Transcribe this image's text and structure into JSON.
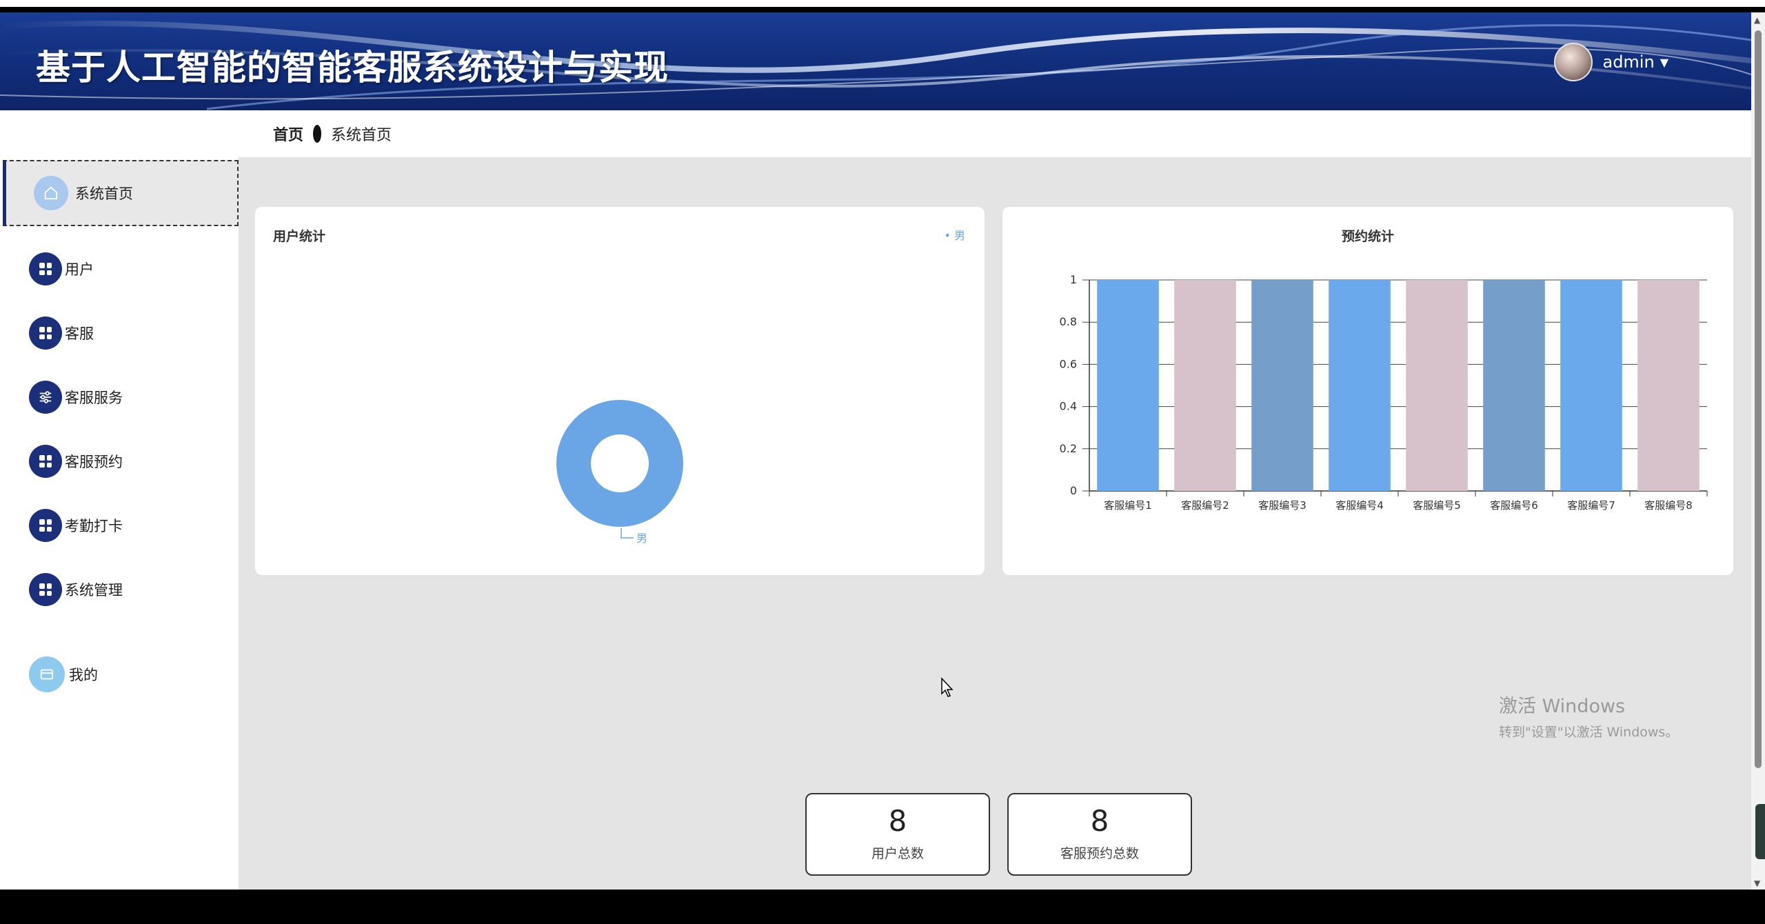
{
  "header": {
    "title": "基于人工智能的智能客服系统设计与实现",
    "username": "admin"
  },
  "breadcrumb": {
    "home": "首页",
    "current": "系统首页"
  },
  "sidebar": {
    "active": {
      "label": "系统首页",
      "icon": "home-icon"
    },
    "items": [
      {
        "label": "用户",
        "icon": "grid-icon"
      },
      {
        "label": "客服",
        "icon": "grid-icon"
      },
      {
        "label": "客服服务",
        "icon": "sliders-icon"
      },
      {
        "label": "客服预约",
        "icon": "grid-icon"
      },
      {
        "label": "考勤打卡",
        "icon": "grid-icon"
      },
      {
        "label": "系统管理",
        "icon": "grid-icon"
      },
      {
        "label": "我的",
        "icon": "card-icon"
      }
    ]
  },
  "cards": {
    "users": {
      "title": "用户统计"
    },
    "appointments": {
      "title": "预约统计"
    }
  },
  "chart_data": [
    {
      "type": "pie",
      "title": "用户统计",
      "categories": [
        "男"
      ],
      "values": [
        8
      ],
      "legend": "top-right",
      "colors": [
        "#6aa6e6"
      ]
    },
    {
      "type": "bar",
      "title": "预约统计",
      "categories": [
        "客服编号1",
        "客服编号2",
        "客服编号3",
        "客服编号4",
        "客服编号5",
        "客服编号6",
        "客服编号7",
        "客服编号8"
      ],
      "values": [
        1,
        1,
        1,
        1,
        1,
        1,
        1,
        1
      ],
      "yticks": [
        "0",
        "0.2",
        "0.4",
        "0.6",
        "0.8",
        "1"
      ],
      "ylim": [
        0,
        1
      ],
      "grid": true,
      "colors": [
        "#6aa9ec",
        "#d7c1ca",
        "#759ecb"
      ]
    }
  ],
  "stats": [
    {
      "value": "8",
      "label": "用户总数"
    },
    {
      "value": "8",
      "label": "客服预约总数"
    }
  ],
  "watermark": {
    "line1": "激活 Windows",
    "line2": "转到\"设置\"以激活 Windows。"
  }
}
